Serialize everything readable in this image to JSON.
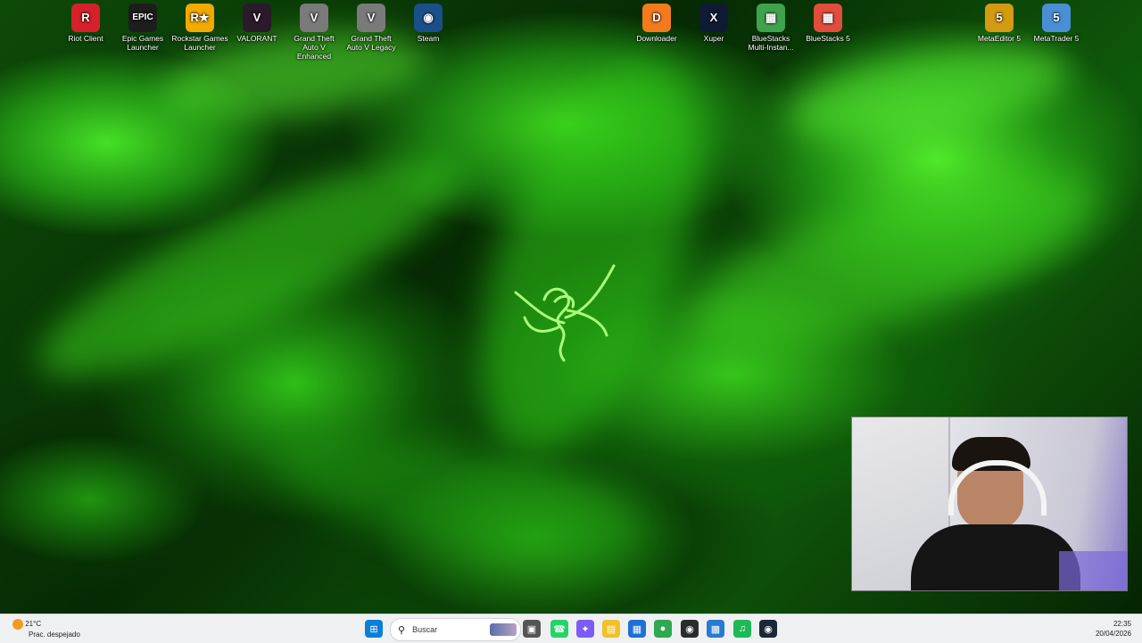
{
  "desktop": {
    "icons_left": [
      {
        "label": "Riot Client",
        "glyph": "R",
        "color": "#d6202b"
      },
      {
        "label": "Epic Games Launcher",
        "glyph": "EPIC",
        "color": "#1d1d1d"
      },
      {
        "label": "Rockstar Games Launcher",
        "glyph": "R★",
        "color": "#f2a900"
      },
      {
        "label": "VALORANT",
        "glyph": "V",
        "color": "#2b1a2a"
      },
      {
        "label": "Grand Theft Auto V Enhanced",
        "glyph": "V",
        "color": "#7a7a7a"
      },
      {
        "label": "Grand Theft Auto V Legacy",
        "glyph": "V",
        "color": "#7a7a7a"
      },
      {
        "label": "Steam",
        "glyph": "◉",
        "color": "#1b4f8a"
      }
    ],
    "icons_right": [
      {
        "label": "Downloader",
        "glyph": "D",
        "color": "#f37b1d"
      },
      {
        "label": "Xuper",
        "glyph": "X",
        "color": "#0e1b33"
      },
      {
        "label": "BlueStacks Multi-Instan...",
        "glyph": "▦",
        "color": "#3fa34d"
      },
      {
        "label": "BlueStacks 5",
        "glyph": "▦",
        "color": "#e24c3d"
      },
      {
        "label": "MetaEditor 5",
        "glyph": "5",
        "color": "#d49a12"
      },
      {
        "label": "MetaTrader 5",
        "glyph": "5",
        "color": "#4a8fd6"
      }
    ]
  },
  "taskbar": {
    "weather_temp": "21°C",
    "weather_desc": "Prac. despejado",
    "search_placeholder": "Buscar",
    "time": "22:35",
    "date": "20/04/2026",
    "apps": [
      {
        "name": "start-button",
        "glyph": "⊞",
        "color": "#0a7fd6"
      },
      {
        "name": "task-view-button",
        "glyph": "▣",
        "color": "#555555"
      },
      {
        "name": "whatsapp-icon",
        "glyph": "☎",
        "color": "#25d366"
      },
      {
        "name": "copilot-icon",
        "glyph": "✦",
        "color": "#7c5cf5"
      },
      {
        "name": "file-explorer-icon",
        "glyph": "▤",
        "color": "#f2c029"
      },
      {
        "name": "store-icon",
        "glyph": "▦",
        "color": "#1e6fd6"
      },
      {
        "name": "chrome-icon",
        "glyph": "●",
        "color": "#2fa84f"
      },
      {
        "name": "obs-icon",
        "glyph": "◉",
        "color": "#2b2b2b"
      },
      {
        "name": "metatrader-icon",
        "glyph": "▩",
        "color": "#2a7ad1"
      },
      {
        "name": "spotify-icon",
        "glyph": "♫",
        "color": "#1db954"
      },
      {
        "name": "steam-icon",
        "glyph": "◉",
        "color": "#1b2838"
      }
    ]
  }
}
